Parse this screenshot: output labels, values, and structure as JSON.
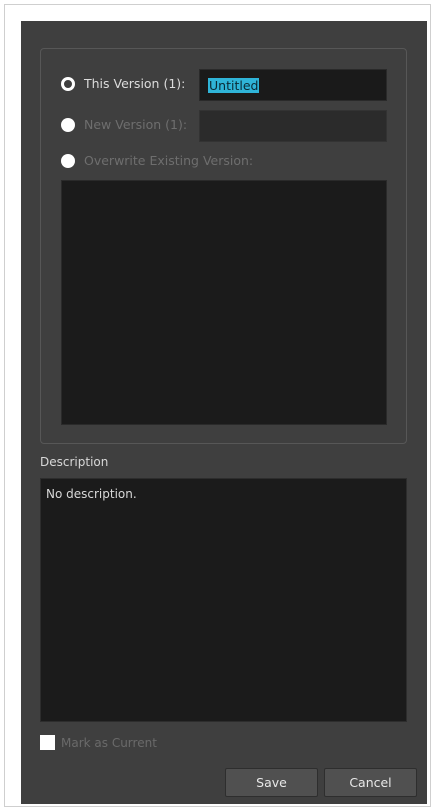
{
  "options": {
    "this_version_label": "This Version (1):",
    "this_version_value": "Untitled",
    "new_version_label": "New Version (1):",
    "new_version_value": "",
    "overwrite_label": "Overwrite Existing Version:"
  },
  "description": {
    "label": "Description",
    "text": "No description."
  },
  "mark_current": {
    "label": "Mark as Current",
    "checked": false
  },
  "buttons": {
    "save": "Save",
    "cancel": "Cancel"
  },
  "colors": {
    "background": "#3f3f3f",
    "field": "#1a1a1a",
    "selection": "#2fb4d8"
  }
}
